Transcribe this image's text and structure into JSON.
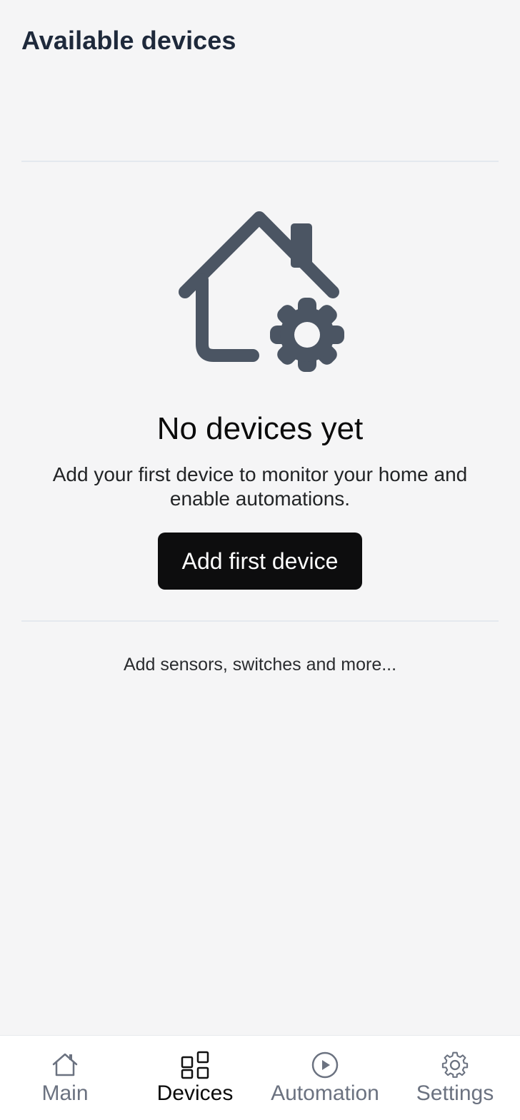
{
  "header": {
    "title": "Available devices"
  },
  "empty_state": {
    "icon": "house-gear-icon",
    "title": "No devices yet",
    "description": "Add your first device to monitor your home and enable automations.",
    "button_label": "Add first device"
  },
  "hint": "Add sensors, switches and more...",
  "colors": {
    "background": "#f5f5f6",
    "primary_button": "#0d0d0e",
    "icon": "#4b5563",
    "nav_inactive": "#6b7280",
    "nav_active": "#0b0b0b"
  },
  "nav": {
    "active": "Devices",
    "items": [
      {
        "label": "Main",
        "icon": "home-icon"
      },
      {
        "label": "Devices",
        "icon": "grid-icon"
      },
      {
        "label": "Automation",
        "icon": "play-circle-icon"
      },
      {
        "label": "Settings",
        "icon": "gear-icon"
      }
    ]
  }
}
